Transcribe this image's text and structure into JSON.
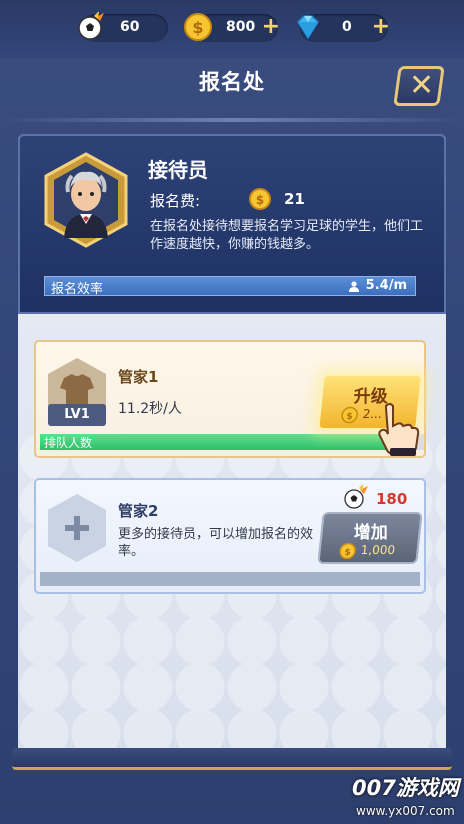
{
  "resources": {
    "football_count": "60",
    "coins": "800",
    "diamonds": "0"
  },
  "header": {
    "title": "报名处"
  },
  "role": {
    "title": "接待员",
    "fee_label": "报名费:",
    "fee_value": "21",
    "description": "在报名处接待想要报名学习足球的学生，他们工作速度越快，你赚的钱越多。",
    "efficiency_label": "报名效率",
    "efficiency_value": "5.4/m"
  },
  "managers": [
    {
      "name": "管家1",
      "level": "LV1",
      "speed": "11.2秒/人",
      "queue_label": "排队人数",
      "queue_fill_fraction": 0.96,
      "button_label": "升级",
      "button_cost": "2..."
    },
    {
      "name": "管家2",
      "description": "更多的接待员，可以增加报名的效率。",
      "hire_count": "180",
      "button_label": "增加",
      "button_cost": "1,000"
    }
  ],
  "watermark": {
    "logo": "007游戏网",
    "url": "www.yx007.com"
  },
  "colors": {
    "accent_gold": "#f2b52d",
    "queue_green": "#2fbf6a",
    "hire_red": "#d23a2a"
  },
  "icons": {
    "football": "football-icon",
    "coin": "coin-icon",
    "diamond": "diamond-icon",
    "close": "close-icon",
    "person": "person-icon",
    "shirt": "shirt-icon",
    "plus": "plus-icon",
    "hand": "hand-pointer-icon"
  }
}
